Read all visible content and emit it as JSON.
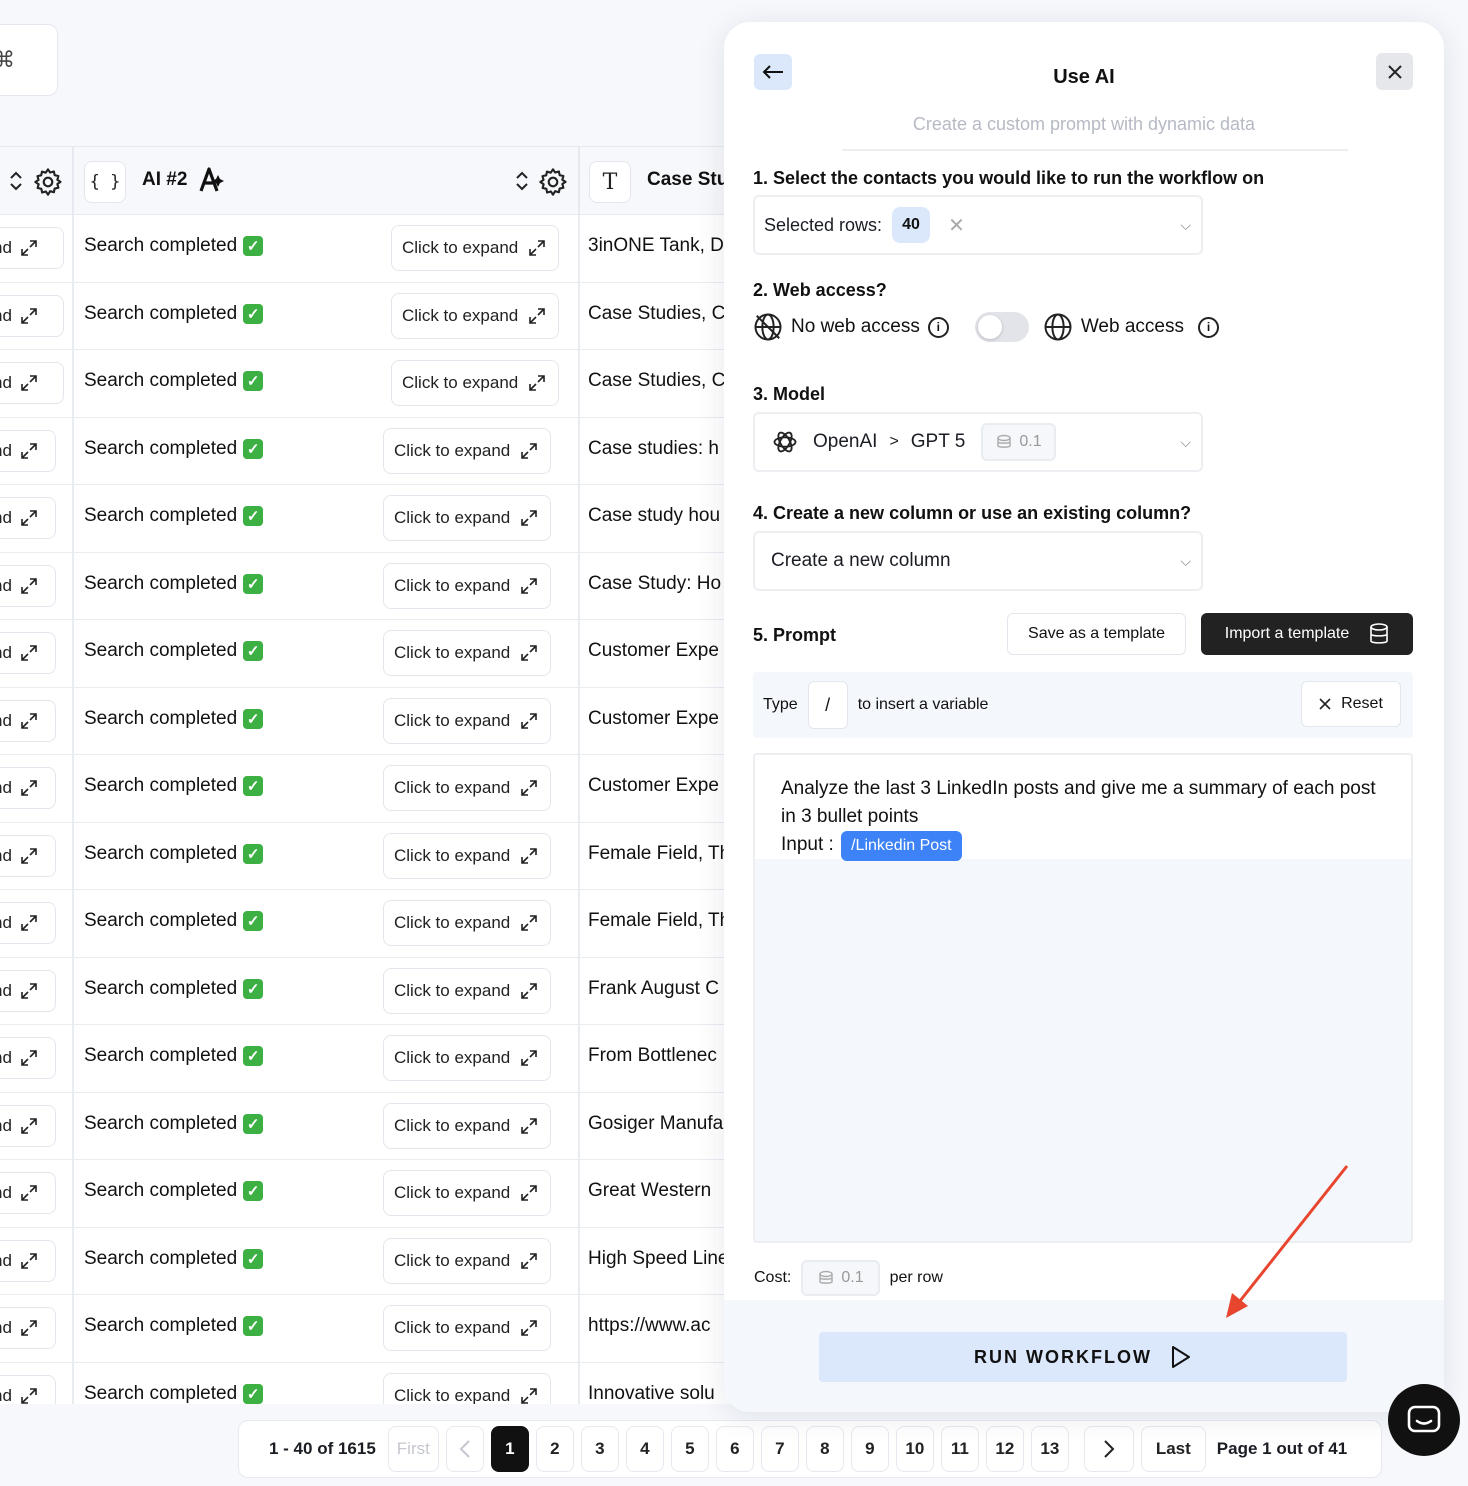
{
  "table": {
    "header": {
      "ai_column_title": "AI #2",
      "ai_column_type_icon": "{ }",
      "case_column_type_icon": "T",
      "case_column_title": "Case Stu"
    },
    "left_cell_text": "nd",
    "status_text": "Search completed",
    "expand_label": "Click to expand",
    "rows": [
      {
        "case": "3inONE Tank, D"
      },
      {
        "case": "Case Studies, C"
      },
      {
        "case": "Case Studies, C"
      },
      {
        "case": "Case studies: h"
      },
      {
        "case": "Case study hou"
      },
      {
        "case": "Case Study: Ho"
      },
      {
        "case": "Customer Expe"
      },
      {
        "case": "Customer Expe"
      },
      {
        "case": "Customer Expe"
      },
      {
        "case": "Female Field, Th"
      },
      {
        "case": "Female Field, Th"
      },
      {
        "case": "Frank August C"
      },
      {
        "case": "From Bottlenec"
      },
      {
        "case": "Gosiger Manufa"
      },
      {
        "case": "Great Western"
      },
      {
        "case": "High Speed Line"
      },
      {
        "case": "https://www.ac"
      },
      {
        "case": "Innovative solu"
      }
    ]
  },
  "pagination": {
    "range": "1 - 40 of 1615",
    "first": "First",
    "last": "Last",
    "pages": [
      "1",
      "2",
      "3",
      "4",
      "5",
      "6",
      "7",
      "8",
      "9",
      "10",
      "11",
      "12",
      "13"
    ],
    "current": "1",
    "page_info": "Page 1 out of 41"
  },
  "panel": {
    "title": "Use AI",
    "subtitle": "Create a custom prompt with dynamic data",
    "step1": {
      "label": "1. Select the contacts you would like to run the workflow on",
      "selected_label": "Selected rows:",
      "selected_count": "40"
    },
    "step2": {
      "label": "2. Web access?",
      "no_web": "No web access",
      "web": "Web access",
      "enabled": false
    },
    "step3": {
      "label": "3. Model",
      "provider": "OpenAI",
      "separator": ">",
      "model": "GPT 5",
      "credits": "0.1"
    },
    "step4": {
      "label": "4. Create a new column or use an existing column?",
      "value": "Create a new column"
    },
    "step5": {
      "label": "5. Prompt",
      "save_template": "Save as a template",
      "import_template": "Import a template",
      "type_label": "Type",
      "slash": "/",
      "insert_hint": "to insert a variable",
      "reset": "Reset",
      "prompt_line1": "Analyze the last 3 LinkedIn posts and give me a summary of each post in 3 bullet points",
      "input_label": "Input :",
      "variable": "/Linkedin Post"
    },
    "cost": {
      "label": "Cost:",
      "credits": "0.1",
      "suffix": "per row"
    },
    "run_button": "RUN WORKFLOW"
  },
  "colors": {
    "accent_blue": "#3d82f6",
    "light_blue": "#dbe8fb",
    "check_green": "#3cb043",
    "annotation_arrow": "#e8452f"
  }
}
